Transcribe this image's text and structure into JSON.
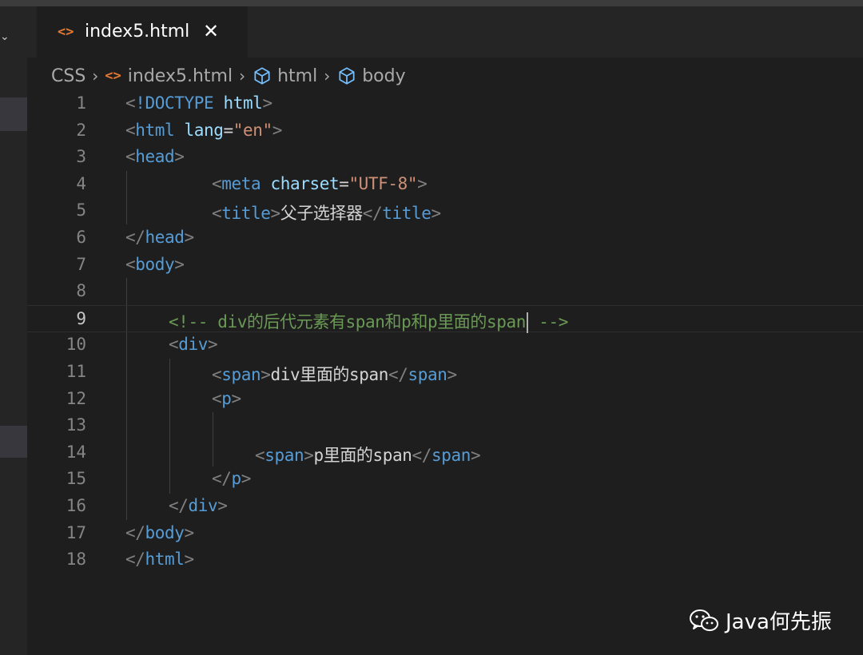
{
  "tab": {
    "filename": "index5.html",
    "file_icon": "html-file-icon",
    "close_icon": "close-icon"
  },
  "breadcrumb": {
    "items": [
      "CSS",
      "index5.html",
      "html",
      "body"
    ]
  },
  "editor": {
    "current_line": 9,
    "lines": [
      {
        "n": "1",
        "tokens": [
          [
            "p",
            "<"
          ],
          [
            "t",
            "!DOCTYPE"
          ],
          [
            "x",
            " "
          ],
          [
            "a",
            "html"
          ],
          [
            "p",
            ">"
          ]
        ]
      },
      {
        "n": "2",
        "tokens": [
          [
            "p",
            "<"
          ],
          [
            "t",
            "html"
          ],
          [
            "x",
            " "
          ],
          [
            "a",
            "lang"
          ],
          [
            "x",
            "="
          ],
          [
            "s",
            "\"en\""
          ],
          [
            "p",
            ">"
          ]
        ]
      },
      {
        "n": "3",
        "tokens": [
          [
            "p",
            "<"
          ],
          [
            "t",
            "head"
          ],
          [
            "p",
            ">"
          ]
        ]
      },
      {
        "n": "4",
        "tokens": [
          [
            "p",
            "<"
          ],
          [
            "t",
            "meta"
          ],
          [
            "x",
            " "
          ],
          [
            "a",
            "charset"
          ],
          [
            "x",
            "="
          ],
          [
            "s",
            "\"UTF-8\""
          ],
          [
            "p",
            ">"
          ]
        ]
      },
      {
        "n": "5",
        "tokens": [
          [
            "p",
            "<"
          ],
          [
            "t",
            "title"
          ],
          [
            "p",
            ">"
          ],
          [
            "x",
            "父子选择器"
          ],
          [
            "p",
            "</"
          ],
          [
            "t",
            "title"
          ],
          [
            "p",
            ">"
          ]
        ]
      },
      {
        "n": "6",
        "tokens": [
          [
            "p",
            "</"
          ],
          [
            "t",
            "head"
          ],
          [
            "p",
            ">"
          ]
        ]
      },
      {
        "n": "7",
        "tokens": [
          [
            "p",
            "<"
          ],
          [
            "t",
            "body"
          ],
          [
            "p",
            ">"
          ]
        ]
      },
      {
        "n": "8",
        "tokens": []
      },
      {
        "n": "9",
        "tokens": [
          [
            "c",
            "<!-- div的后代元素有span和p和p里面的span"
          ],
          [
            "caret",
            ""
          ],
          [
            "c",
            " -->"
          ]
        ]
      },
      {
        "n": "10",
        "tokens": [
          [
            "p",
            "<"
          ],
          [
            "t",
            "div"
          ],
          [
            "p",
            ">"
          ]
        ]
      },
      {
        "n": "11",
        "tokens": [
          [
            "p",
            "<"
          ],
          [
            "t",
            "span"
          ],
          [
            "p",
            ">"
          ],
          [
            "x",
            "div里面的span"
          ],
          [
            "p",
            "</"
          ],
          [
            "t",
            "span"
          ],
          [
            "p",
            ">"
          ]
        ]
      },
      {
        "n": "12",
        "tokens": [
          [
            "p",
            "<"
          ],
          [
            "t",
            "p"
          ],
          [
            "p",
            ">"
          ]
        ]
      },
      {
        "n": "13",
        "tokens": []
      },
      {
        "n": "14",
        "tokens": [
          [
            "p",
            "<"
          ],
          [
            "t",
            "span"
          ],
          [
            "p",
            ">"
          ],
          [
            "x",
            "p里面的span"
          ],
          [
            "p",
            "</"
          ],
          [
            "t",
            "span"
          ],
          [
            "p",
            ">"
          ]
        ]
      },
      {
        "n": "15",
        "tokens": [
          [
            "p",
            "</"
          ],
          [
            "t",
            "p"
          ],
          [
            "p",
            ">"
          ]
        ]
      },
      {
        "n": "16",
        "tokens": [
          [
            "p",
            "</"
          ],
          [
            "t",
            "div"
          ],
          [
            "p",
            ">"
          ]
        ]
      },
      {
        "n": "17",
        "tokens": [
          [
            "p",
            "</"
          ],
          [
            "t",
            "body"
          ],
          [
            "p",
            ">"
          ]
        ]
      },
      {
        "n": "18",
        "tokens": [
          [
            "p",
            "</"
          ],
          [
            "t",
            "html"
          ],
          [
            "p",
            ">"
          ]
        ]
      }
    ]
  },
  "watermark": {
    "text": "Java何先振",
    "icon": "wechat-icon"
  },
  "colors": {
    "background": "#1e1e1e",
    "tag": "#569cd6",
    "attribute": "#9cdcfe",
    "string": "#ce9178",
    "comment": "#6a9955",
    "punctuation": "#808080",
    "file_icon": "#e37933"
  }
}
